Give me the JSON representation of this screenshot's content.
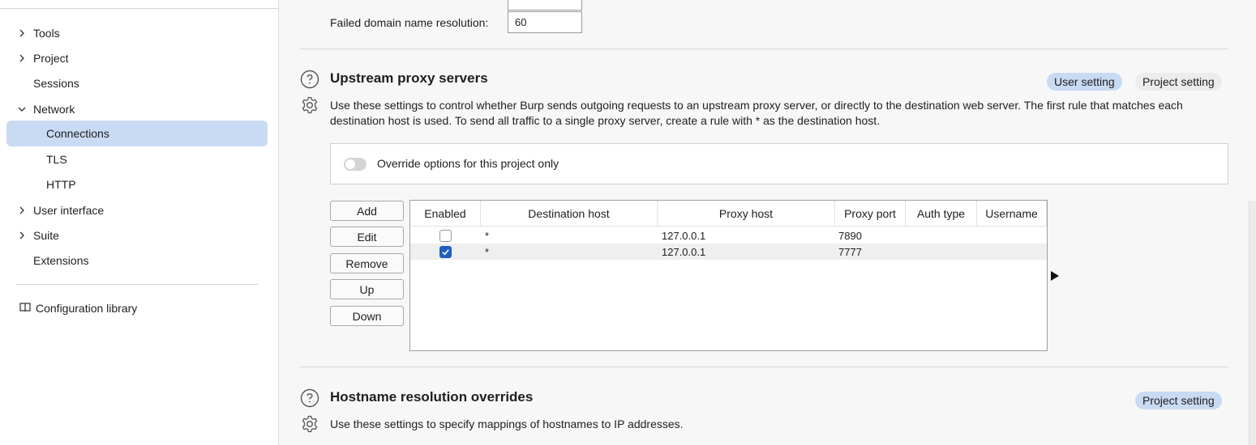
{
  "sidebar": {
    "items": [
      {
        "label": "Tools",
        "chevron": "right",
        "level": 0,
        "selected": false
      },
      {
        "label": "Project",
        "chevron": "right",
        "level": 0,
        "selected": false
      },
      {
        "label": "Sessions",
        "chevron": "",
        "level": 0,
        "selected": false
      },
      {
        "label": "Network",
        "chevron": "down",
        "level": 0,
        "selected": false
      },
      {
        "label": "Connections",
        "chevron": "",
        "level": 1,
        "selected": true
      },
      {
        "label": "TLS",
        "chevron": "",
        "level": 1,
        "selected": false
      },
      {
        "label": "HTTP",
        "chevron": "",
        "level": 1,
        "selected": false
      },
      {
        "label": "User interface",
        "chevron": "right",
        "level": 0,
        "selected": false
      },
      {
        "label": "Suite",
        "chevron": "right",
        "level": 0,
        "selected": false
      },
      {
        "label": "Extensions",
        "chevron": "",
        "level": 0,
        "selected": false
      }
    ],
    "config_library": {
      "label": "Configuration library",
      "icon": "book-icon"
    }
  },
  "dns": {
    "failed_label": "Failed domain name resolution:",
    "failed_value": "60"
  },
  "upstream": {
    "title": "Upstream proxy servers",
    "description": "Use these settings to  control whether Burp sends outgoing requests to an upstream proxy server, or directly to the destination web server. The first rule that matches each destination host is used. To send all traffic to a single proxy server, create a rule with * as the destination host.",
    "user_setting": "User setting",
    "project_setting": "Project setting",
    "override_label": "Override options for this project only",
    "override_enabled": false,
    "buttons": {
      "add": "Add",
      "edit": "Edit",
      "remove": "Remove",
      "up": "Up",
      "down": "Down"
    },
    "columns": [
      "Enabled",
      "Destination host",
      "Proxy host",
      "Proxy port",
      "Auth type",
      "Username"
    ],
    "rows": [
      {
        "enabled": false,
        "destination": "*",
        "proxy_host": "127.0.0.1",
        "proxy_port": "7890",
        "auth_type": "",
        "username": ""
      },
      {
        "enabled": true,
        "destination": "*",
        "proxy_host": "127.0.0.1",
        "proxy_port": "7777",
        "auth_type": "",
        "username": ""
      }
    ]
  },
  "hostname": {
    "title": "Hostname resolution overrides",
    "description": "Use these settings to specify mappings of hostnames to IP addresses.",
    "project_setting": "Project setting"
  },
  "colors": {
    "selected_bg": "#c9daf3",
    "checkbox_checked": "#1f5fbf",
    "pill_inactive": "#ececec"
  }
}
